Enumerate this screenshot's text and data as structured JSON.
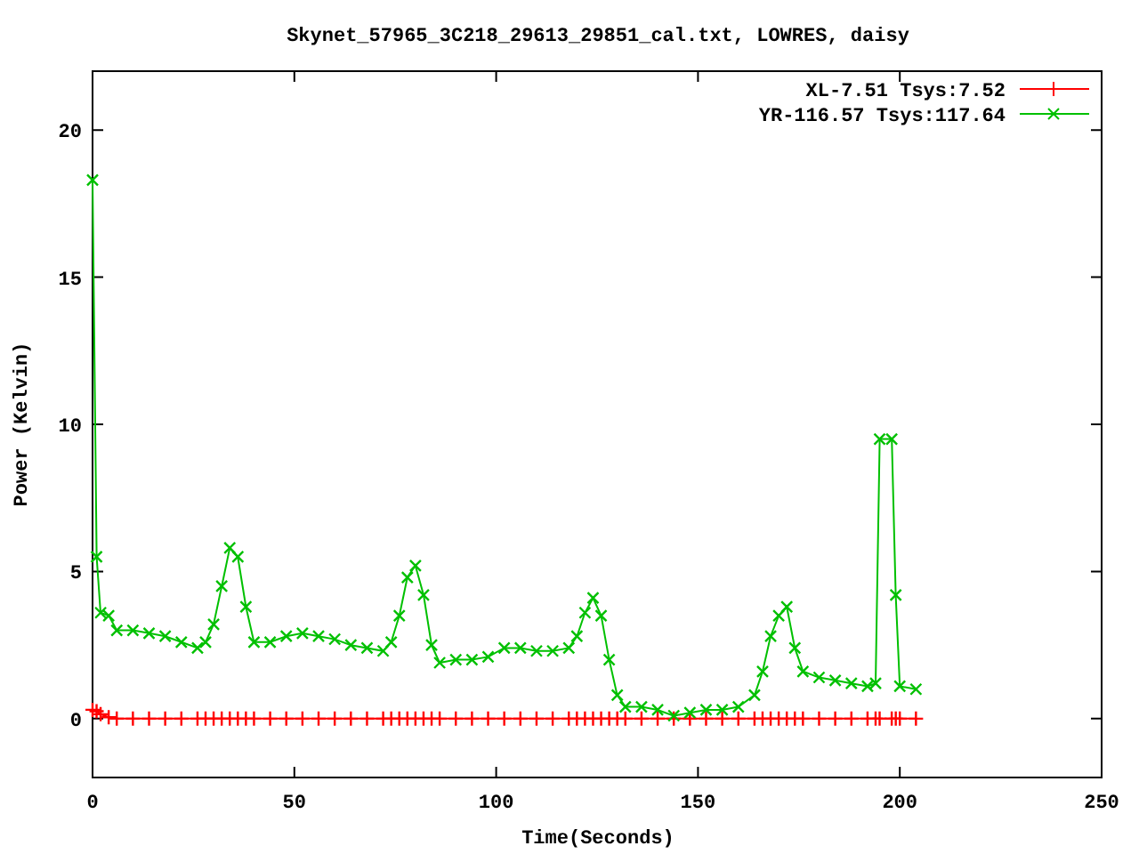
{
  "chart_data": {
    "type": "line",
    "title": "Skynet_57965_3C218_29613_29851_cal.txt, LOWRES, daisy",
    "xlabel": "Time(Seconds)",
    "ylabel": "Power (Kelvin)",
    "xlim": [
      0,
      250
    ],
    "ylim": [
      -2,
      22
    ],
    "xticks": [
      0,
      50,
      100,
      150,
      200,
      250
    ],
    "yticks": [
      0,
      5,
      10,
      15,
      20
    ],
    "legend": true,
    "x": [
      0,
      1,
      2,
      4,
      6,
      10,
      14,
      18,
      22,
      26,
      28,
      30,
      32,
      34,
      36,
      38,
      40,
      44,
      48,
      52,
      56,
      60,
      64,
      68,
      72,
      74,
      76,
      78,
      80,
      82,
      84,
      86,
      90,
      94,
      98,
      102,
      106,
      110,
      114,
      118,
      120,
      122,
      124,
      126,
      128,
      130,
      132,
      136,
      140,
      144,
      148,
      152,
      156,
      160,
      164,
      166,
      168,
      170,
      172,
      174,
      176,
      180,
      184,
      188,
      192,
      194,
      195,
      198,
      199,
      200,
      204
    ],
    "series": [
      {
        "name": "XL-7.51 Tsys:7.52",
        "color": "#ff0000",
        "marker": "plus",
        "values": [
          0.3,
          0.25,
          0.15,
          0.05,
          0,
          0,
          0,
          0,
          0,
          0,
          0,
          0,
          0,
          0,
          0,
          0,
          0,
          0,
          0,
          0,
          0,
          0,
          0,
          0,
          0,
          0,
          0,
          0,
          0,
          0,
          0,
          0,
          0,
          0,
          0,
          0,
          0,
          0,
          0,
          0,
          0,
          0,
          0,
          0,
          0,
          0,
          0,
          0,
          0,
          0,
          0,
          0,
          0,
          0,
          0,
          0,
          0,
          0,
          0,
          0,
          0,
          0,
          0,
          0,
          0,
          0,
          0,
          0,
          0,
          0,
          0
        ]
      },
      {
        "name": "YR-116.57 Tsys:117.64",
        "color": "#00c000",
        "marker": "x",
        "values": [
          18.3,
          5.5,
          3.6,
          3.5,
          3.0,
          3.0,
          2.9,
          2.8,
          2.6,
          2.4,
          2.6,
          3.2,
          4.5,
          5.8,
          5.5,
          3.8,
          2.6,
          2.6,
          2.8,
          2.9,
          2.8,
          2.7,
          2.5,
          2.4,
          2.3,
          2.6,
          3.5,
          4.8,
          5.2,
          4.2,
          2.5,
          1.9,
          2.0,
          2.0,
          2.1,
          2.4,
          2.4,
          2.3,
          2.3,
          2.4,
          2.8,
          3.6,
          4.1,
          3.5,
          2.0,
          0.8,
          0.4,
          0.4,
          0.3,
          0.1,
          0.2,
          0.3,
          0.3,
          0.4,
          0.8,
          1.6,
          2.8,
          3.5,
          3.8,
          2.4,
          1.6,
          1.4,
          1.3,
          1.2,
          1.1,
          1.2,
          9.5,
          9.5,
          4.2,
          1.1,
          1.0
        ]
      }
    ]
  }
}
